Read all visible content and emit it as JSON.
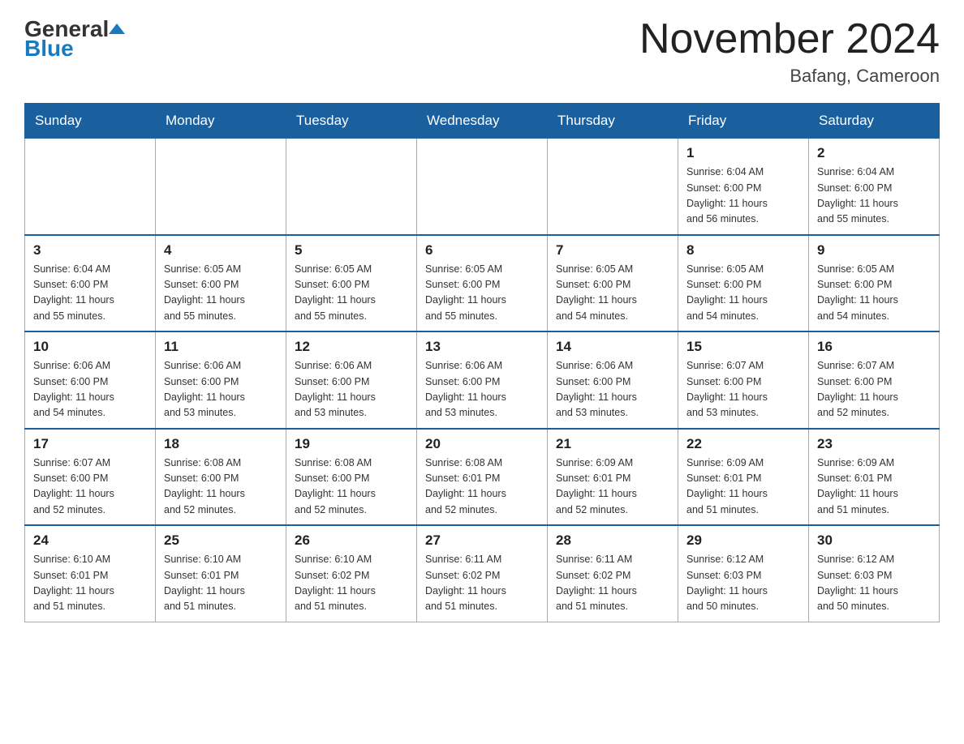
{
  "header": {
    "logo_general": "General",
    "logo_blue": "Blue",
    "month_title": "November 2024",
    "location": "Bafang, Cameroon"
  },
  "days_of_week": [
    "Sunday",
    "Monday",
    "Tuesday",
    "Wednesday",
    "Thursday",
    "Friday",
    "Saturday"
  ],
  "weeks": [
    [
      {
        "day": "",
        "info": ""
      },
      {
        "day": "",
        "info": ""
      },
      {
        "day": "",
        "info": ""
      },
      {
        "day": "",
        "info": ""
      },
      {
        "day": "",
        "info": ""
      },
      {
        "day": "1",
        "info": "Sunrise: 6:04 AM\nSunset: 6:00 PM\nDaylight: 11 hours\nand 56 minutes."
      },
      {
        "day": "2",
        "info": "Sunrise: 6:04 AM\nSunset: 6:00 PM\nDaylight: 11 hours\nand 55 minutes."
      }
    ],
    [
      {
        "day": "3",
        "info": "Sunrise: 6:04 AM\nSunset: 6:00 PM\nDaylight: 11 hours\nand 55 minutes."
      },
      {
        "day": "4",
        "info": "Sunrise: 6:05 AM\nSunset: 6:00 PM\nDaylight: 11 hours\nand 55 minutes."
      },
      {
        "day": "5",
        "info": "Sunrise: 6:05 AM\nSunset: 6:00 PM\nDaylight: 11 hours\nand 55 minutes."
      },
      {
        "day": "6",
        "info": "Sunrise: 6:05 AM\nSunset: 6:00 PM\nDaylight: 11 hours\nand 55 minutes."
      },
      {
        "day": "7",
        "info": "Sunrise: 6:05 AM\nSunset: 6:00 PM\nDaylight: 11 hours\nand 54 minutes."
      },
      {
        "day": "8",
        "info": "Sunrise: 6:05 AM\nSunset: 6:00 PM\nDaylight: 11 hours\nand 54 minutes."
      },
      {
        "day": "9",
        "info": "Sunrise: 6:05 AM\nSunset: 6:00 PM\nDaylight: 11 hours\nand 54 minutes."
      }
    ],
    [
      {
        "day": "10",
        "info": "Sunrise: 6:06 AM\nSunset: 6:00 PM\nDaylight: 11 hours\nand 54 minutes."
      },
      {
        "day": "11",
        "info": "Sunrise: 6:06 AM\nSunset: 6:00 PM\nDaylight: 11 hours\nand 53 minutes."
      },
      {
        "day": "12",
        "info": "Sunrise: 6:06 AM\nSunset: 6:00 PM\nDaylight: 11 hours\nand 53 minutes."
      },
      {
        "day": "13",
        "info": "Sunrise: 6:06 AM\nSunset: 6:00 PM\nDaylight: 11 hours\nand 53 minutes."
      },
      {
        "day": "14",
        "info": "Sunrise: 6:06 AM\nSunset: 6:00 PM\nDaylight: 11 hours\nand 53 minutes."
      },
      {
        "day": "15",
        "info": "Sunrise: 6:07 AM\nSunset: 6:00 PM\nDaylight: 11 hours\nand 53 minutes."
      },
      {
        "day": "16",
        "info": "Sunrise: 6:07 AM\nSunset: 6:00 PM\nDaylight: 11 hours\nand 52 minutes."
      }
    ],
    [
      {
        "day": "17",
        "info": "Sunrise: 6:07 AM\nSunset: 6:00 PM\nDaylight: 11 hours\nand 52 minutes."
      },
      {
        "day": "18",
        "info": "Sunrise: 6:08 AM\nSunset: 6:00 PM\nDaylight: 11 hours\nand 52 minutes."
      },
      {
        "day": "19",
        "info": "Sunrise: 6:08 AM\nSunset: 6:00 PM\nDaylight: 11 hours\nand 52 minutes."
      },
      {
        "day": "20",
        "info": "Sunrise: 6:08 AM\nSunset: 6:01 PM\nDaylight: 11 hours\nand 52 minutes."
      },
      {
        "day": "21",
        "info": "Sunrise: 6:09 AM\nSunset: 6:01 PM\nDaylight: 11 hours\nand 52 minutes."
      },
      {
        "day": "22",
        "info": "Sunrise: 6:09 AM\nSunset: 6:01 PM\nDaylight: 11 hours\nand 51 minutes."
      },
      {
        "day": "23",
        "info": "Sunrise: 6:09 AM\nSunset: 6:01 PM\nDaylight: 11 hours\nand 51 minutes."
      }
    ],
    [
      {
        "day": "24",
        "info": "Sunrise: 6:10 AM\nSunset: 6:01 PM\nDaylight: 11 hours\nand 51 minutes."
      },
      {
        "day": "25",
        "info": "Sunrise: 6:10 AM\nSunset: 6:01 PM\nDaylight: 11 hours\nand 51 minutes."
      },
      {
        "day": "26",
        "info": "Sunrise: 6:10 AM\nSunset: 6:02 PM\nDaylight: 11 hours\nand 51 minutes."
      },
      {
        "day": "27",
        "info": "Sunrise: 6:11 AM\nSunset: 6:02 PM\nDaylight: 11 hours\nand 51 minutes."
      },
      {
        "day": "28",
        "info": "Sunrise: 6:11 AM\nSunset: 6:02 PM\nDaylight: 11 hours\nand 51 minutes."
      },
      {
        "day": "29",
        "info": "Sunrise: 6:12 AM\nSunset: 6:03 PM\nDaylight: 11 hours\nand 50 minutes."
      },
      {
        "day": "30",
        "info": "Sunrise: 6:12 AM\nSunset: 6:03 PM\nDaylight: 11 hours\nand 50 minutes."
      }
    ]
  ]
}
